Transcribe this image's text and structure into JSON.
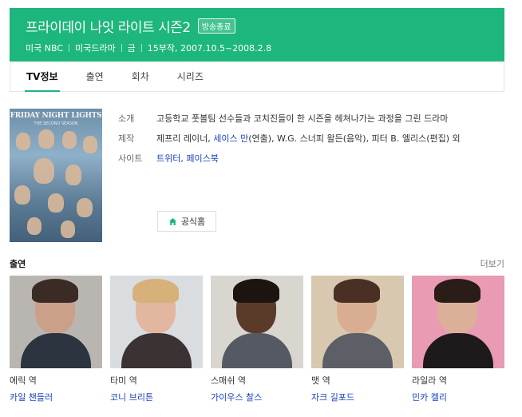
{
  "header": {
    "title": "프라이데이 나잇 라이트 시즌2",
    "badge": "방송종료",
    "meta": [
      "미국 NBC",
      "미국드라마",
      "금",
      "15부작, 2007.10.5~2008.2.8"
    ]
  },
  "tabs": [
    {
      "label": "TV정보",
      "active": true
    },
    {
      "label": "출연",
      "active": false
    },
    {
      "label": "회차",
      "active": false
    },
    {
      "label": "시리즈",
      "active": false
    }
  ],
  "poster": {
    "title": "FRIDAY NIGHT LIGHTS",
    "subtitle": "THE SECOND SEASON"
  },
  "info": {
    "summary_label": "소개",
    "summary": "고등학교 풋볼팀 선수들과 코치진들이 한 시즌을 헤쳐나가는 과정을 그린 드라마",
    "staff_label": "제작",
    "staff_1": "제프리 레이너, ",
    "staff_link": "세이스 만",
    "staff_2": "(연출), W.G. 스너피 왈든(음악), 피터 B. 엘리스(편집) 외",
    "site_label": "사이트",
    "site_links": [
      "트위터",
      "페이스북"
    ],
    "site_sep": ", ",
    "home_button": "공식홈"
  },
  "cast": {
    "title": "출연",
    "more": "더보기",
    "items": [
      {
        "role": "에릭 역",
        "actor": "카일 챈들러"
      },
      {
        "role": "타미 역",
        "actor": "코니 브리튼"
      },
      {
        "role": "스매쉬 역",
        "actor": "가이우스 찰스"
      },
      {
        "role": "맷 역",
        "actor": "자크 길포드"
      },
      {
        "role": "라일라 역",
        "actor": "민카 켈리"
      }
    ]
  },
  "colors": {
    "accent": "#1db67c",
    "link": "#1a3fbf"
  }
}
